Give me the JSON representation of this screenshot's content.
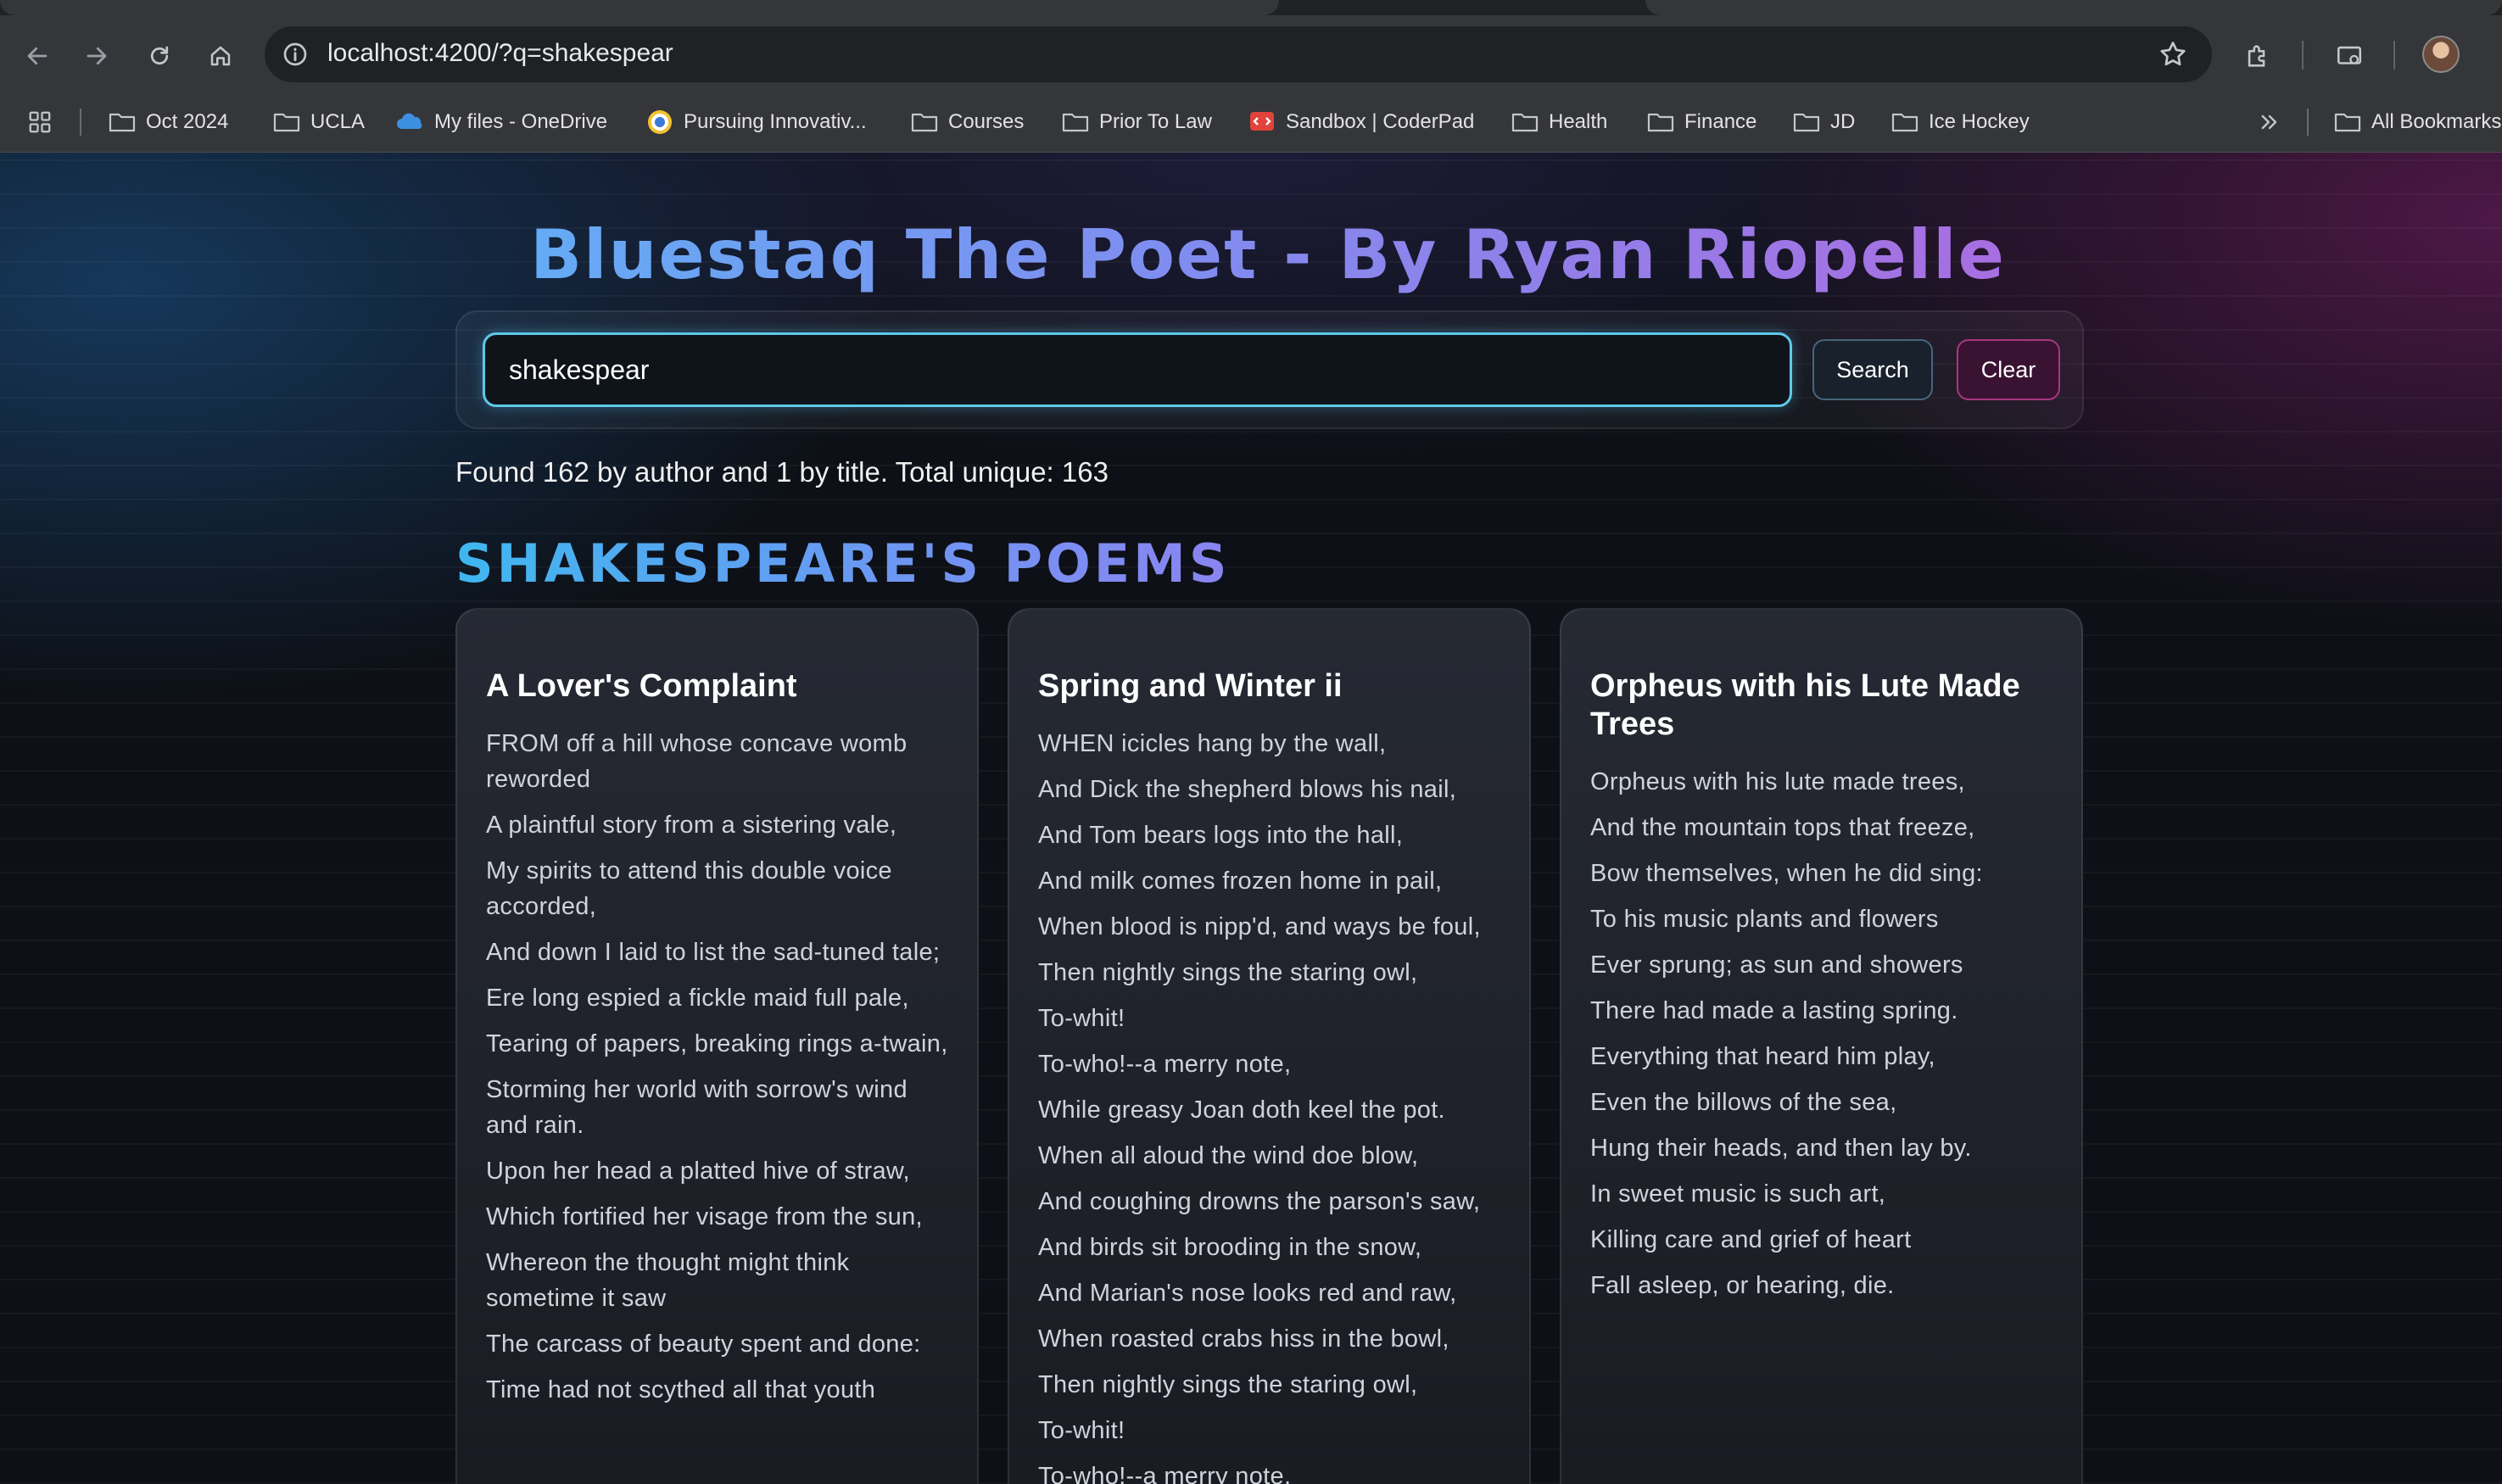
{
  "browser": {
    "url": "localhost:4200/?q=shakespear",
    "bookmarks": [
      {
        "label": "Oct 2024",
        "icon": "folder-icon"
      },
      {
        "label": "UCLA",
        "icon": "folder-icon"
      },
      {
        "label": "My files - OneDrive",
        "icon": "onedrive-icon"
      },
      {
        "label": "Pursuing Innovativ...",
        "icon": "site-favicon-icon"
      },
      {
        "label": "Courses",
        "icon": "folder-icon"
      },
      {
        "label": "Prior To Law",
        "icon": "folder-icon"
      },
      {
        "label": "Sandbox | CoderPad",
        "icon": "coderpad-icon"
      },
      {
        "label": "Health",
        "icon": "folder-icon"
      },
      {
        "label": "Finance",
        "icon": "folder-icon"
      },
      {
        "label": "JD",
        "icon": "folder-icon"
      },
      {
        "label": "Ice Hockey",
        "icon": "folder-icon"
      }
    ],
    "all_bookmarks_label": "All Bookmarks"
  },
  "app": {
    "title": "Bluestaq The Poet - By Ryan Riopelle",
    "search": {
      "value": "shakespear",
      "search_label": "Search",
      "clear_label": "Clear"
    },
    "summary": "Found 162 by author and 1 by title. Total unique: 163",
    "section_title": "SHAKESPEARE'S POEMS"
  },
  "poems": [
    {
      "title": "A Lover's Complaint",
      "lines": [
        "FROM off a hill whose concave womb reworded",
        "A plaintful story from a sistering vale,",
        "My spirits to attend this double voice accorded,",
        "And down I laid to list the sad-tuned tale;",
        "Ere long espied a fickle maid full pale,",
        "Tearing of papers, breaking rings a-twain,",
        "Storming her world with sorrow's wind and rain.",
        "Upon her head a platted hive of straw,",
        "Which fortified her visage from the sun,",
        "Whereon the thought might think sometime it saw",
        "The carcass of beauty spent and done:",
        "Time had not scythed all that youth"
      ]
    },
    {
      "title": "Spring and Winter ii",
      "lines": [
        "WHEN icicles hang by the wall,",
        "And Dick the shepherd blows his nail,",
        "And Tom bears logs into the hall,",
        "And milk comes frozen home in pail,",
        "When blood is nipp'd, and ways be foul,",
        "Then nightly sings the staring owl,",
        "To-whit!",
        "To-who!--a merry note,",
        "While greasy Joan doth keel the pot.",
        "When all aloud the wind doe blow,",
        "And coughing drowns the parson's saw,",
        "And birds sit brooding in the snow,",
        "And Marian's nose looks red and raw,",
        "When roasted crabs hiss in the bowl,",
        "Then nightly sings the staring owl,",
        "To-whit!",
        "To-who!--a merry note,"
      ]
    },
    {
      "title": "Orpheus with his Lute Made Trees",
      "lines": [
        "Orpheus with his lute made trees,",
        "And the mountain tops that freeze,",
        "Bow themselves, when he did sing:",
        "To his music plants and flowers",
        "Ever sprung; as sun and showers",
        "There had made a lasting spring.",
        "Everything that heard him play,",
        "Even the billows of the sea,",
        "Hung their heads, and then lay by.",
        "In sweet music is such art,",
        "Killing care and grief of heart",
        "Fall asleep, or hearing, die."
      ]
    }
  ]
}
